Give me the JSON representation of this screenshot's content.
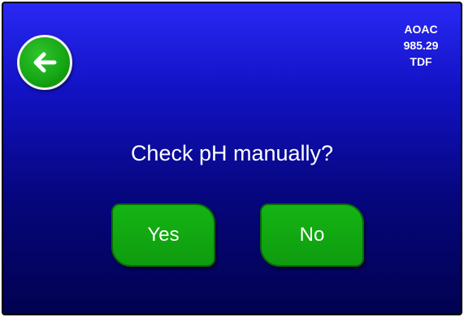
{
  "header": {
    "method_line1": "AOAC",
    "method_line2": "985.29",
    "method_line3": "TDF"
  },
  "back_button": {
    "icon": "arrow-left-icon"
  },
  "dialog": {
    "prompt": "Check pH manually?",
    "yes_label": "Yes",
    "no_label": "No"
  },
  "colors": {
    "background_top": "#2828f4",
    "background_bottom": "#020250",
    "button_green": "#14b414",
    "text": "#ffffff"
  }
}
